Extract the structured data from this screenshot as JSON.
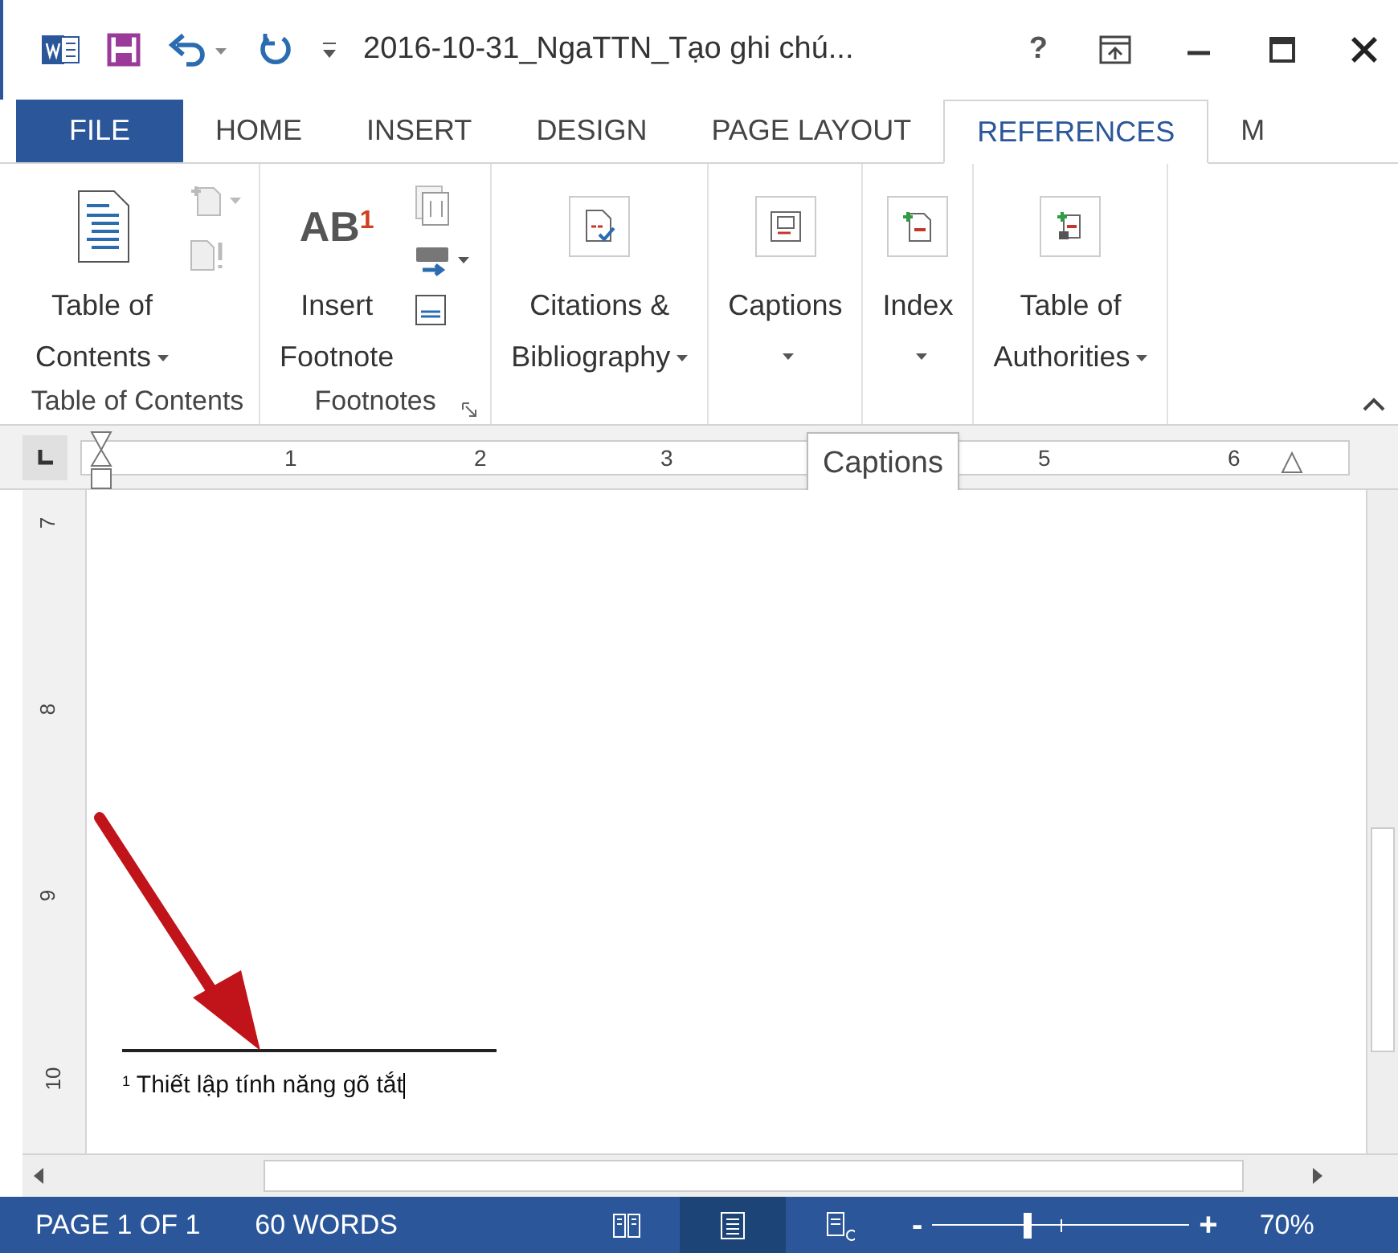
{
  "window": {
    "title": "2016-10-31_NgaTTN_Tạo ghi chú...",
    "help": "?"
  },
  "tabs": [
    {
      "label": "FILE",
      "selected": false,
      "kind": "file"
    },
    {
      "label": "HOME",
      "selected": false,
      "kind": "tab"
    },
    {
      "label": "INSERT",
      "selected": false,
      "kind": "tab"
    },
    {
      "label": "DESIGN",
      "selected": false,
      "kind": "tab"
    },
    {
      "label": "PAGE LAYOUT",
      "selected": false,
      "kind": "tab"
    },
    {
      "label": "REFERENCES",
      "selected": true,
      "kind": "tab"
    },
    {
      "label": "M",
      "selected": false,
      "kind": "tab"
    }
  ],
  "ribbon_groups": [
    {
      "label": "Table of Contents",
      "buttons": [
        {
          "kind": "toc",
          "lines": [
            "Table of",
            "Contents"
          ],
          "dropdown": true
        }
      ]
    },
    {
      "label": "Footnotes",
      "launcher": true,
      "buttons": [
        {
          "kind": "footnote",
          "lines": [
            "Insert",
            "Footnote"
          ],
          "dropdown": false,
          "icon_text": "AB",
          "icon_sup": "1"
        }
      ]
    },
    {
      "buttons": [
        {
          "kind": "citations",
          "lines": [
            "Citations &",
            "Bibliography"
          ],
          "dropdown": true
        }
      ]
    },
    {
      "buttons": [
        {
          "kind": "captions",
          "lines": [
            "Captions"
          ],
          "dropdown": true
        }
      ]
    },
    {
      "buttons": [
        {
          "kind": "index",
          "lines": [
            "Index"
          ],
          "dropdown": true
        }
      ]
    },
    {
      "buttons": [
        {
          "kind": "authorities",
          "lines": [
            "Table of",
            "Authorities"
          ],
          "dropdown": true
        }
      ]
    }
  ],
  "ruler": {
    "numbers": [
      "1",
      "2",
      "3",
      "5",
      "6"
    ],
    "tooltip": "Captions"
  },
  "vertical_ruler": {
    "numbers": [
      "7",
      "8",
      "9",
      "10"
    ]
  },
  "footnote": {
    "mark": "1",
    "text": "Thiết lập tính năng gõ tắt"
  },
  "status_bar": {
    "page": "PAGE 1 OF 1",
    "words": "60 WORDS",
    "views": [
      {
        "selected": false
      },
      {
        "selected": true
      },
      {
        "selected": false
      }
    ],
    "zoom": {
      "level": 0.37,
      "minus": "-",
      "plus": "+",
      "reading": "70%"
    }
  }
}
